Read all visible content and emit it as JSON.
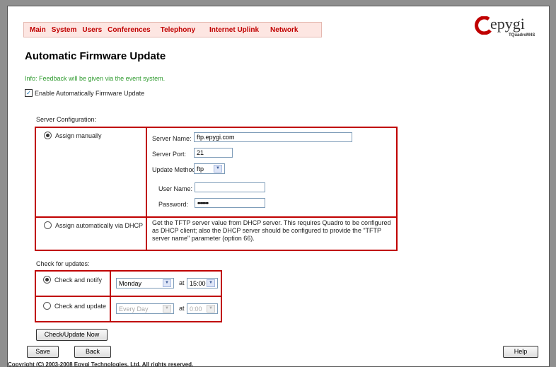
{
  "menu": [
    "Main",
    "System",
    "Users",
    "Conferences",
    "Telephony",
    "Internet Uplink",
    "Network"
  ],
  "logo": {
    "word": "epygi",
    "model": "TQuadroM4S"
  },
  "page_title": "Automatic Firmware Update",
  "info_text": "Info: Feedback will be given via the event system.",
  "enable_label": "Enable Automatically Firmware Update",
  "enable_checked": true,
  "server_config_label": "Server Configuration:",
  "assign_manual_label": "Assign manually",
  "assign_dhcp_label": "Assign automatically via DHCP",
  "server_name_label": "Server Name:",
  "server_name_value": "ftp.epygi.com",
  "server_port_label": "Server Port:",
  "server_port_value": "21",
  "update_method_label": "Update Method:",
  "update_method_value": "ftp",
  "user_name_label": "User Name:",
  "user_name_value": "",
  "password_label": "Password:",
  "password_value": "•••••••",
  "dhcp_desc": "Get the TFTP server value from DHCP server. This requires Quadro to be configured as DHCP client; also the DHCP server should be configured to provide the \"TFTP server name\" parameter (option 66).",
  "check_updates_label": "Check for updates:",
  "check_notify_label": "Check and notify",
  "check_update_label": "Check and update",
  "notify_day": "Monday",
  "notify_time": "15:00",
  "update_day": "Every Day",
  "update_time": "0:00",
  "at_label": "at",
  "check_now_button": "Check/Update Now",
  "save_button": "Save",
  "back_button": "Back",
  "help_button": "Help",
  "copyright": "Copyright (C) 2003-2008 Epygi Technologies, Ltd. All rights reserved."
}
